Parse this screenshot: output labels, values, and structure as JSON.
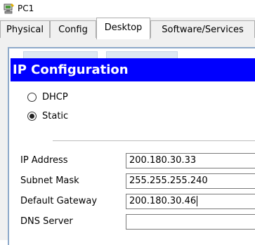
{
  "window": {
    "title": "PC1",
    "icon": "pc-icon"
  },
  "tabs": [
    {
      "label": "Physical",
      "active": false
    },
    {
      "label": "Config",
      "active": false
    },
    {
      "label": "Desktop",
      "active": true
    },
    {
      "label": "Software/Services",
      "active": false
    }
  ],
  "ip_config": {
    "title": "IP Configuration",
    "mode_options": [
      {
        "label": "DHCP",
        "selected": false
      },
      {
        "label": "Static",
        "selected": true
      }
    ],
    "fields": [
      {
        "label": "IP Address",
        "value": "200.180.30.33"
      },
      {
        "label": "Subnet Mask",
        "value": "255.255.255.240"
      },
      {
        "label": "Default Gateway",
        "value": "200.180.30.46"
      },
      {
        "label": "DNS Server",
        "value": ""
      }
    ]
  },
  "colors": {
    "header_bg": "#0000ff",
    "header_text": "#ffffff",
    "tab_bg": "#f0f0f0"
  }
}
